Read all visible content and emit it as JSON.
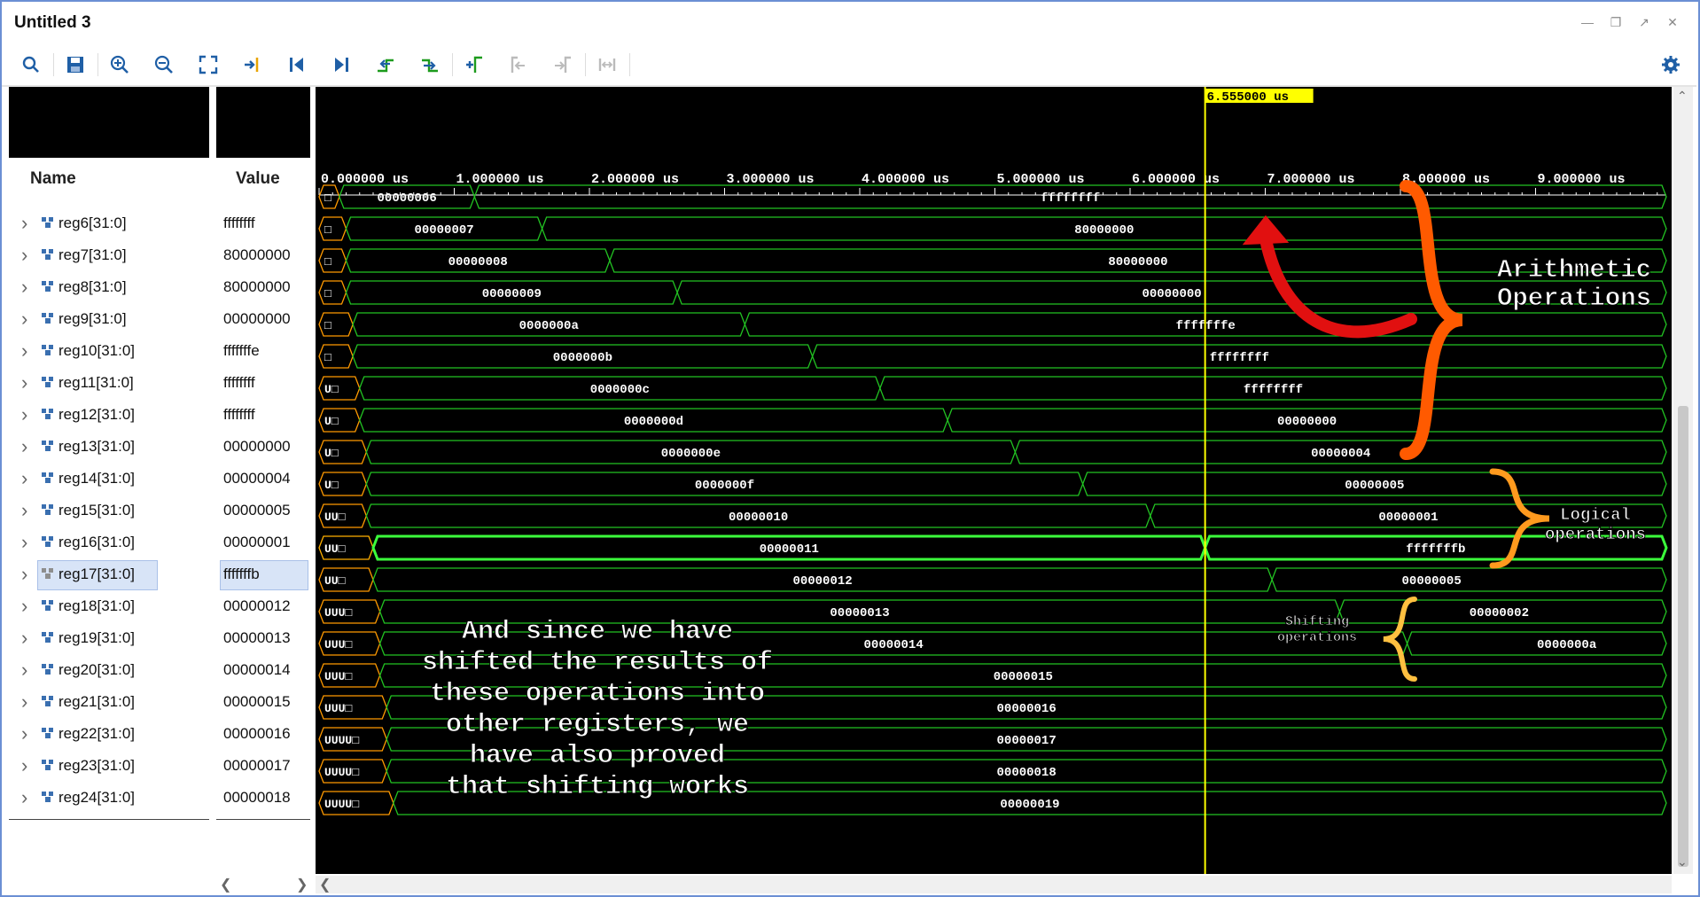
{
  "window": {
    "title": "Untitled 3"
  },
  "toolbar": {
    "icons": [
      "search-icon",
      "save-icon",
      "zoom-in-icon",
      "zoom-out-icon",
      "zoom-fit-icon",
      "go-to-cursor-icon",
      "go-to-start-icon",
      "go-to-end-icon",
      "previous-transition-icon",
      "next-transition-icon",
      "add-marker-icon",
      "previous-marker-icon",
      "next-marker-icon",
      "swap-cursors-icon",
      "settings-gear-icon"
    ]
  },
  "columns": {
    "name": "Name",
    "value": "Value"
  },
  "cursor": {
    "label": "6.555000 us",
    "time_us": 6.555
  },
  "timeline": {
    "ticks": [
      "0.000000 us",
      "1.000000 us",
      "2.000000 us",
      "3.000000 us",
      "4.000000 us",
      "5.000000 us",
      "6.000000 us",
      "7.000000 us",
      "8.000000 us",
      "9.000000 us"
    ],
    "range_us": [
      0,
      10
    ]
  },
  "signals": [
    {
      "name": "reg6[31:0]",
      "value": "ffffffff",
      "init": "□",
      "first": "00000006",
      "second": "ffffffff",
      "t_init": 0.15,
      "t_change": 1.15
    },
    {
      "name": "reg7[31:0]",
      "value": "80000000",
      "init": "□",
      "first": "00000007",
      "second": "80000000",
      "t_init": 0.2,
      "t_change": 1.65
    },
    {
      "name": "reg8[31:0]",
      "value": "80000000",
      "init": "□",
      "first": "00000008",
      "second": "80000000",
      "t_init": 0.2,
      "t_change": 2.15
    },
    {
      "name": "reg9[31:0]",
      "value": "00000000",
      "init": "□",
      "first": "00000009",
      "second": "00000000",
      "t_init": 0.2,
      "t_change": 2.65
    },
    {
      "name": "reg10[31:0]",
      "value": "fffffffe",
      "init": "□",
      "first": "0000000a",
      "second": "fffffffe",
      "t_init": 0.25,
      "t_change": 3.15
    },
    {
      "name": "reg11[31:0]",
      "value": "ffffffff",
      "init": "□",
      "first": "0000000b",
      "second": "ffffffff",
      "t_init": 0.25,
      "t_change": 3.65
    },
    {
      "name": "reg12[31:0]",
      "value": "ffffffff",
      "init": "U□",
      "first": "0000000c",
      "second": "ffffffff",
      "t_init": 0.3,
      "t_change": 4.15
    },
    {
      "name": "reg13[31:0]",
      "value": "00000000",
      "init": "U□",
      "first": "0000000d",
      "second": "00000000",
      "t_init": 0.3,
      "t_change": 4.65
    },
    {
      "name": "reg14[31:0]",
      "value": "00000004",
      "init": "U□",
      "first": "0000000e",
      "second": "00000004",
      "t_init": 0.35,
      "t_change": 5.15
    },
    {
      "name": "reg15[31:0]",
      "value": "00000005",
      "init": "U□",
      "first": "0000000f",
      "second": "00000005",
      "t_init": 0.35,
      "t_change": 5.65
    },
    {
      "name": "reg16[31:0]",
      "value": "00000001",
      "init": "UU□",
      "first": "00000010",
      "second": "00000001",
      "t_init": 0.35,
      "t_change": 6.15
    },
    {
      "name": "reg17[31:0]",
      "value": "fffffffb",
      "init": "UU□",
      "first": "00000011",
      "second": "fffffffb",
      "t_init": 0.4,
      "t_change": 6.555,
      "selected": true
    },
    {
      "name": "reg18[31:0]",
      "value": "00000012",
      "init": "UU□",
      "first": "00000012",
      "second": "00000005",
      "t_init": 0.4,
      "t_change": 7.05
    },
    {
      "name": "reg19[31:0]",
      "value": "00000013",
      "init": "UUU□",
      "first": "00000013",
      "second": "00000002",
      "t_init": 0.45,
      "t_change": 7.55
    },
    {
      "name": "reg20[31:0]",
      "value": "00000014",
      "init": "UUU□",
      "first": "00000014",
      "second": "0000000a",
      "t_init": 0.45,
      "t_change": 8.05
    },
    {
      "name": "reg21[31:0]",
      "value": "00000015",
      "init": "UUU□",
      "first": "00000015",
      "second": "",
      "t_init": 0.45,
      "t_change": null
    },
    {
      "name": "reg22[31:0]",
      "value": "00000016",
      "init": "UUU□",
      "first": "00000016",
      "second": "",
      "t_init": 0.5,
      "t_change": null
    },
    {
      "name": "reg23[31:0]",
      "value": "00000017",
      "init": "UUUU□",
      "first": "00000017",
      "second": "",
      "t_init": 0.5,
      "t_change": null
    },
    {
      "name": "reg24[31:0]",
      "value": "00000018",
      "init": "UUUU□",
      "first": "00000018",
      "second": "",
      "t_init": 0.5,
      "t_change": null
    },
    {
      "name": "",
      "value": "",
      "init": "UUUU□",
      "first": "00000019",
      "second": "",
      "t_init": 0.55,
      "t_change": null
    }
  ],
  "annotations": {
    "arithmetic": "Arithmetic\nOperations",
    "logical": "Logical\noperations",
    "shifting": "Shifting\noperations",
    "note": "And since we have\nshifted the results of\nthese operations into\nother registers, we\nhave also proved\nthat shifting works"
  },
  "colors": {
    "wave": "#22c322",
    "selected_wave": "#3bff3b",
    "cursor": "#ffff00",
    "arithmetic_brace": "#ff5a00",
    "logical_brace": "#ff9a1e",
    "shifting_brace": "#ffc040",
    "arrow": "#e11010"
  }
}
